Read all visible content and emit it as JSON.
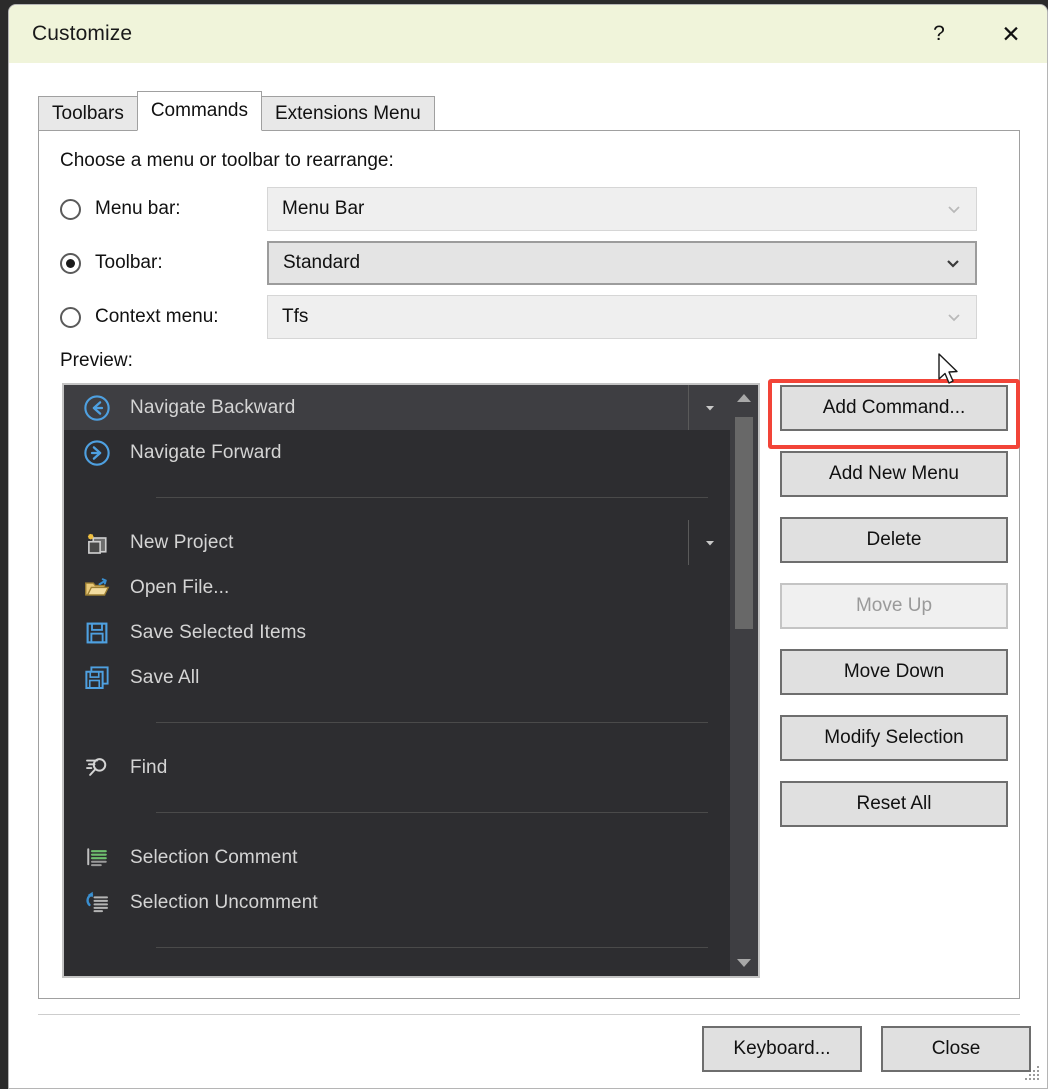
{
  "window": {
    "title": "Customize",
    "help_label": "?",
    "close_label": "✕",
    "titlebar_color": "#f0f4da"
  },
  "tabs": [
    {
      "label": "Toolbars",
      "active": false
    },
    {
      "label": "Commands",
      "active": true
    },
    {
      "label": "Extensions Menu",
      "active": false
    }
  ],
  "panel": {
    "instruction": "Choose a menu or toolbar to rearrange:",
    "preview_label": "Preview:",
    "radios": [
      {
        "label": "Menu bar:",
        "checked": false,
        "value": "Menu Bar"
      },
      {
        "label": "Toolbar:",
        "checked": true,
        "value": "Standard"
      },
      {
        "label": "Context menu:",
        "checked": false,
        "value": "Tfs"
      }
    ]
  },
  "preview_list": {
    "items": [
      {
        "label": "Navigate Backward",
        "icon": "navigate-backward-icon",
        "selected": true,
        "split": true
      },
      {
        "label": "Navigate Forward",
        "icon": "navigate-forward-icon",
        "selected": false,
        "split": false
      },
      {
        "label": "New Project",
        "icon": "new-project-icon",
        "selected": false,
        "split": true
      },
      {
        "label": "Open File...",
        "icon": "open-file-icon",
        "selected": false,
        "split": false
      },
      {
        "label": "Save Selected Items",
        "icon": "save-icon",
        "selected": false,
        "split": false
      },
      {
        "label": "Save All",
        "icon": "save-all-icon",
        "selected": false,
        "split": false
      },
      {
        "label": "Find",
        "icon": "find-icon",
        "selected": false,
        "split": false
      },
      {
        "label": "Selection Comment",
        "icon": "comment-icon",
        "selected": false,
        "split": false
      },
      {
        "label": "Selection Uncomment",
        "icon": "uncomment-icon",
        "selected": false,
        "split": false
      }
    ],
    "background": "#2d2d30",
    "selected_background": "#3e3e42"
  },
  "side_buttons": [
    {
      "label": "Add Command...",
      "disabled": false,
      "highlighted": true
    },
    {
      "label": "Add New Menu",
      "disabled": false,
      "highlighted": false
    },
    {
      "label": "Delete",
      "disabled": false,
      "highlighted": false
    },
    {
      "label": "Move Up",
      "disabled": true,
      "highlighted": false
    },
    {
      "label": "Move Down",
      "disabled": false,
      "highlighted": false
    },
    {
      "label": "Modify Selection",
      "disabled": false,
      "highlighted": false
    },
    {
      "label": "Reset All",
      "disabled": false,
      "highlighted": false
    }
  ],
  "footer": {
    "keyboard_label": "Keyboard...",
    "close_label": "Close"
  },
  "annotation": {
    "color": "#f24438",
    "target": "Add Command..."
  }
}
